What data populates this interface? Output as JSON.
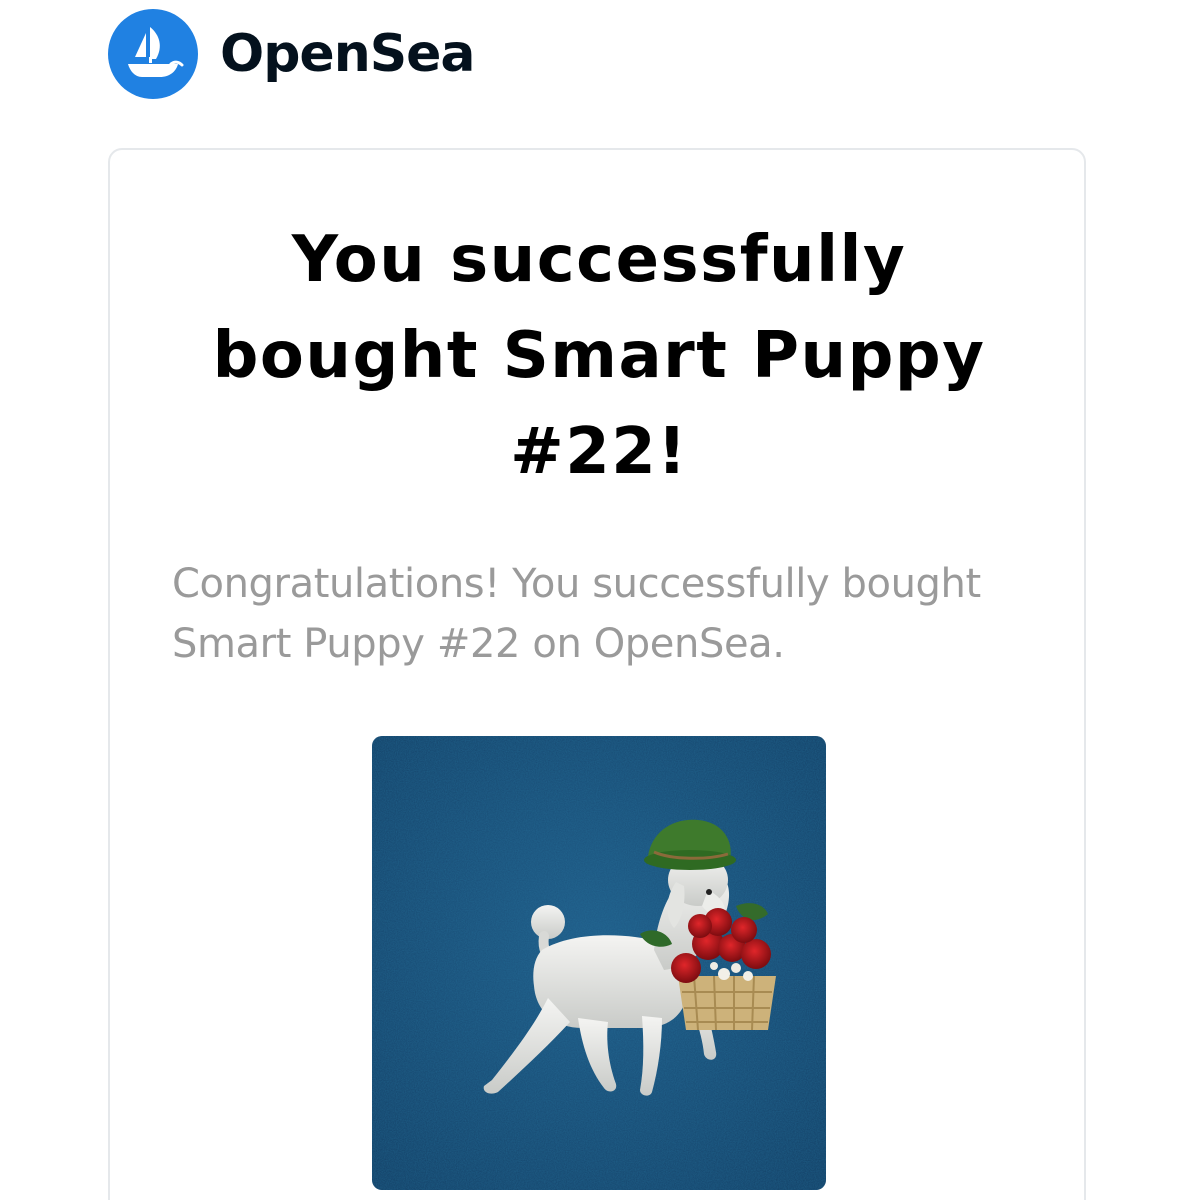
{
  "header": {
    "brand_name": "OpenSea",
    "logo_icon": "opensea-ship-icon",
    "accent_color": "#2081e2"
  },
  "card": {
    "headline": "You successfully bought Smart Puppy #22!",
    "message": "Congratulations! You successfully bought Smart Puppy #22 on OpenSea.",
    "image_subject": "nft-artwork-poodle-with-roses"
  }
}
